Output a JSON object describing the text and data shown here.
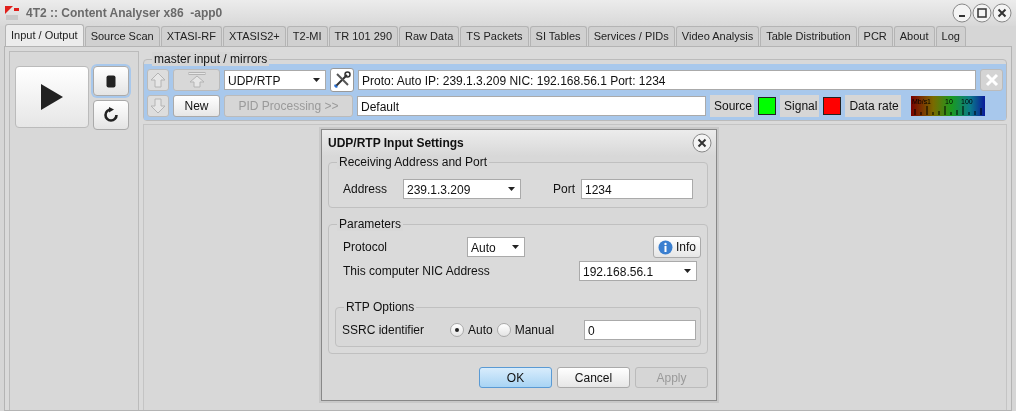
{
  "window": {
    "title": "4T2 :: Content Analyser x86  -app0"
  },
  "tabs": [
    {
      "label": "Input / Output",
      "selected": true
    },
    {
      "label": "Source Scan",
      "selected": false
    },
    {
      "label": "XTASI-RF",
      "selected": false
    },
    {
      "label": "XTASIS2+",
      "selected": false
    },
    {
      "label": "T2-MI",
      "selected": false
    },
    {
      "label": "TR 101 290",
      "selected": false
    },
    {
      "label": "Raw Data",
      "selected": false
    },
    {
      "label": "TS Packets",
      "selected": false
    },
    {
      "label": "SI Tables",
      "selected": false
    },
    {
      "label": "Services / PIDs",
      "selected": false
    },
    {
      "label": "Video Analysis",
      "selected": false
    },
    {
      "label": "Table Distribution",
      "selected": false
    },
    {
      "label": "PCR",
      "selected": false
    },
    {
      "label": "About",
      "selected": false
    },
    {
      "label": "Log",
      "selected": false
    }
  ],
  "master_input": {
    "title": "master input / mirrors",
    "source_type": "UDP/RTP",
    "new_button": "New",
    "pid_button": {
      "label": "PID Processing >>",
      "disabled": true
    },
    "summary": "Proto: Auto IP: 239.1.3.209 NIC: 192.168.56.1 Port: 1234",
    "name": "Default",
    "indicators": [
      {
        "label": "Source",
        "color": "#00ff00"
      },
      {
        "label": "Signal",
        "color": "#ff0000"
      }
    ],
    "data_rate": {
      "label": "Data rate",
      "scale": [
        "Mb/s",
        "1",
        "10",
        "100"
      ]
    }
  },
  "dialog": {
    "title": "UDP/RTP Input Settings",
    "receiving": {
      "title": "Receiving Address and Port",
      "address_label": "Address",
      "address": "239.1.3.209",
      "port_label": "Port",
      "port": "1234"
    },
    "parameters": {
      "title": "Parameters",
      "protocol_label": "Protocol",
      "protocol": "Auto",
      "info_button": "Info",
      "nic_label": "This computer NIC Address",
      "nic": "192.168.56.1",
      "rtp_options": {
        "title": "RTP Options",
        "ssrc_label": "SSRC identifier",
        "modes": [
          {
            "label": "Auto",
            "selected": true
          },
          {
            "label": "Manual",
            "selected": false
          }
        ],
        "ssrc": "0"
      }
    },
    "buttons": [
      {
        "label": "OK",
        "kind": "default",
        "disabled": false
      },
      {
        "label": "Cancel",
        "kind": "normal",
        "disabled": false
      },
      {
        "label": "Apply",
        "kind": "normal",
        "disabled": true
      }
    ]
  }
}
